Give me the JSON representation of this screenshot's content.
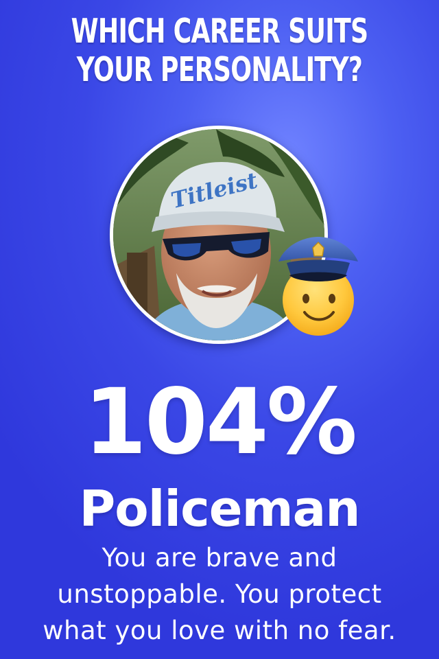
{
  "quiz": {
    "title_line1": "WHICH CAREER SUITS",
    "title_line2": "YOUR PERSONALITY?"
  },
  "result": {
    "percentage": "104%",
    "career": "Policeman",
    "description_line1": "You are brave and",
    "description_line2": "unstoppable. You protect",
    "description_line3": "what you love with no fear."
  },
  "profile_photo": {
    "subject": "smiling man in cap and sunglasses",
    "cap_logo": "Titleist"
  },
  "icons": {
    "career_emoji": "police-officer-emoji"
  },
  "colors": {
    "background": "#3a47e6",
    "text": "#ffffff",
    "emoji_face": "#ffc83d",
    "police_cap": "#3f63b8"
  }
}
